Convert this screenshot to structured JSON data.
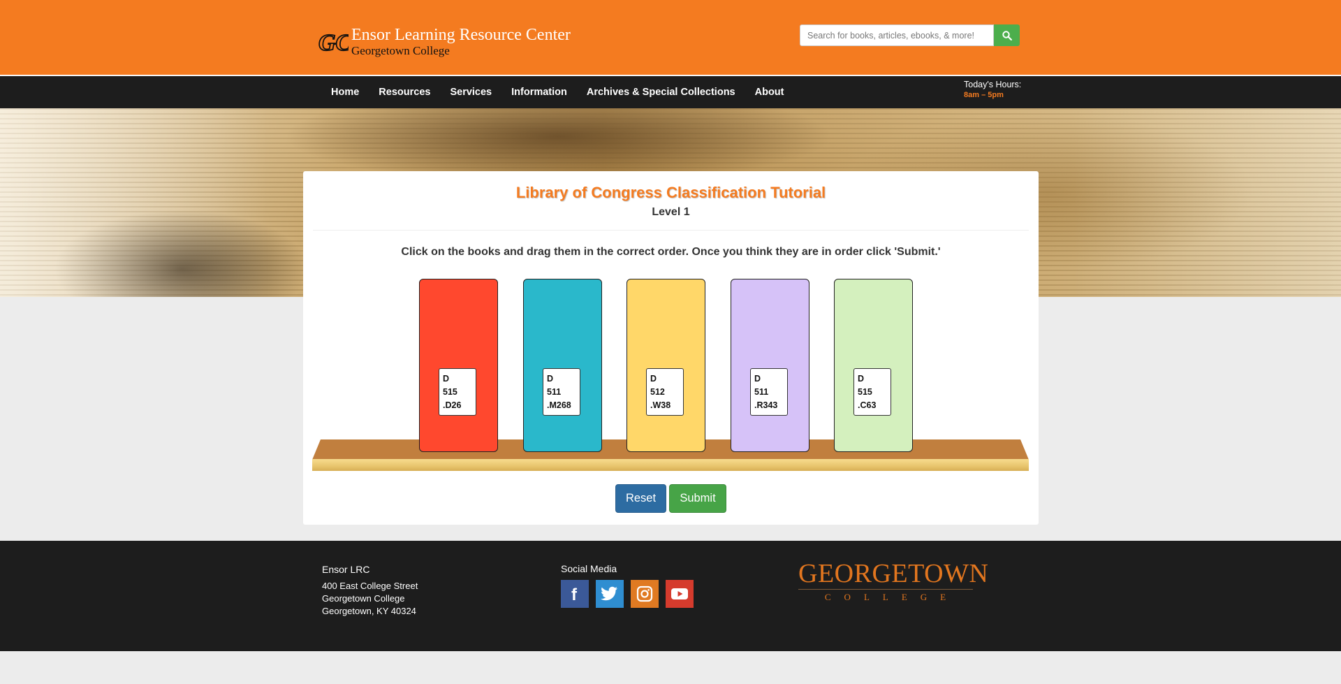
{
  "header": {
    "logo_monogram": "GC",
    "logo_title": "Ensor Learning Resource Center",
    "logo_subtitle": "Georgetown College",
    "search_placeholder": "Search for books, articles, ebooks, & more!",
    "search_icon": "search-icon",
    "colors": {
      "orange": "#f47b20",
      "search_button": "#4cae4c"
    }
  },
  "nav": {
    "items": [
      {
        "label": "Home"
      },
      {
        "label": "Resources"
      },
      {
        "label": "Services"
      },
      {
        "label": "Information"
      },
      {
        "label": "Archives & Special Collections"
      },
      {
        "label": "About"
      }
    ],
    "hours_label": "Today's Hours:",
    "hours_value": "8am – 5pm"
  },
  "tutorial": {
    "title": "Library of Congress Classification Tutorial",
    "level": "Level 1",
    "instructions": "Click on the books and drag them in the correct order. Once you think they are in order click 'Submit.'",
    "books": [
      {
        "color": "#ff482e",
        "line1": "D",
        "line2": "515",
        "line3": ".D26"
      },
      {
        "color": "#2ab8cb",
        "line1": "D",
        "line2": "511",
        "line3": ".M268"
      },
      {
        "color": "#ffd769",
        "line1": "D",
        "line2": "512",
        "line3": ".W38"
      },
      {
        "color": "#d6c2f8",
        "line1": "D",
        "line2": "511",
        "line3": ".R343"
      },
      {
        "color": "#d4f0be",
        "line1": "D",
        "line2": "515",
        "line3": ".C63"
      }
    ],
    "reset_label": "Reset",
    "submit_label": "Submit"
  },
  "footer": {
    "org_name": "Ensor LRC",
    "address_line1": "400 East College Street",
    "address_line2": "Georgetown College",
    "address_line3": "Georgetown, KY 40324",
    "social_heading": "Social Media",
    "social": [
      {
        "icon": "facebook-icon",
        "color": "#3b5998"
      },
      {
        "icon": "twitter-icon",
        "color": "#2f8ed1"
      },
      {
        "icon": "instagram-icon",
        "color": "#e07a22"
      },
      {
        "icon": "youtube-icon",
        "color": "#d53b2d"
      }
    ],
    "college_logo_big": "GEORGETOWN",
    "college_logo_small": "COLLEGE"
  }
}
